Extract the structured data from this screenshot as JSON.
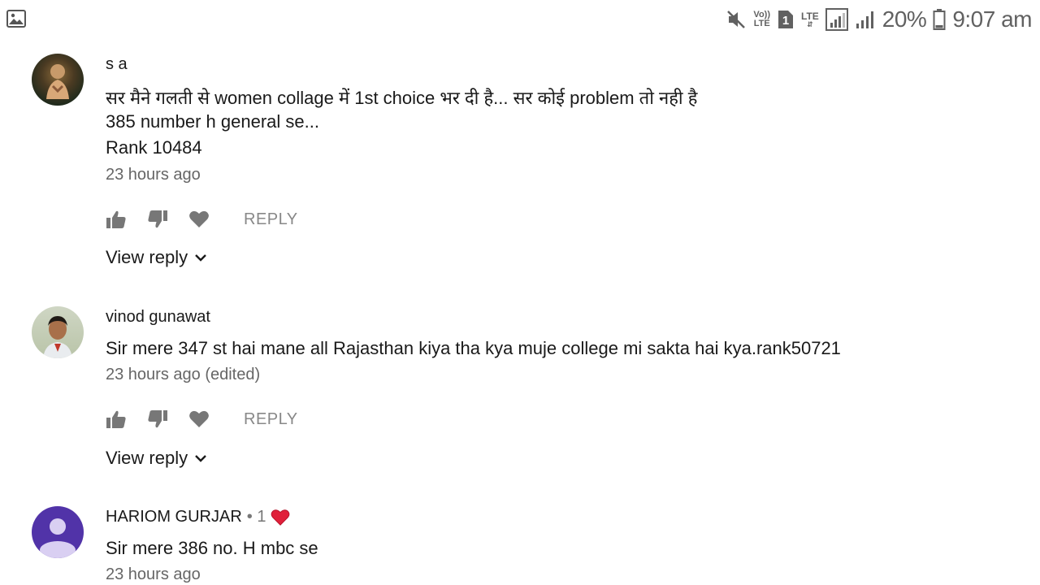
{
  "statusbar": {
    "sim_slot": "1",
    "volte": [
      "Vo))",
      "LTE"
    ],
    "lte": "LTE",
    "battery_percent": "20%",
    "time": "9:07 am",
    "icons": [
      "gallery-icon",
      "mute-icon",
      "volte-icon",
      "sim-icon",
      "lte-data-icon",
      "signal-icon",
      "signal-icon",
      "battery-icon"
    ]
  },
  "comments": [
    {
      "author": "s a",
      "lines": [
        "सर मैने गलती से women collage में 1st choice भर दी है... सर कोई problem तो नही है",
        "385 number h general se...",
        "Rank 10484"
      ],
      "time": "23 hours ago",
      "reply_label": "REPLY",
      "view_reply": "View reply"
    },
    {
      "author": "vinod gunawat",
      "lines": [
        "Sir mere 347 st hai mane all Rajasthan kiya tha kya muje college mi sakta hai kya.rank50721"
      ],
      "time": "23 hours ago (edited)",
      "reply_label": "REPLY",
      "view_reply": "View reply"
    },
    {
      "author": "HARIOM GURJAR",
      "author_meta": "• 1",
      "lines": [
        "Sir mere 386 no. H mbc se"
      ],
      "time": "23 hours ago"
    }
  ],
  "colors": {
    "avatar_purple": "#5133a8",
    "heart_red": "#e0203a",
    "action_gray": "#777777"
  }
}
